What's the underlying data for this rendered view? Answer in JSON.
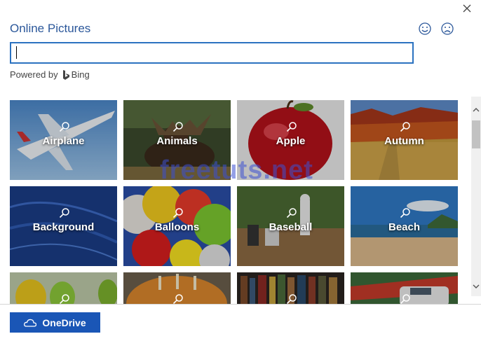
{
  "dialog": {
    "title": "Online Pictures",
    "close_icon": "close-icon",
    "feedback": {
      "smile_icon": "smile-icon",
      "frown_icon": "frown-icon"
    }
  },
  "search": {
    "value": "",
    "placeholder": ""
  },
  "powered_by": {
    "text": "Powered by",
    "brand": "Bing"
  },
  "categories": [
    {
      "label": "Airplane",
      "icon": "search-icon"
    },
    {
      "label": "Animals",
      "icon": "search-icon"
    },
    {
      "label": "Apple",
      "icon": "search-icon"
    },
    {
      "label": "Autumn",
      "icon": "search-icon"
    },
    {
      "label": "Background",
      "icon": "search-icon"
    },
    {
      "label": "Balloons",
      "icon": "search-icon"
    },
    {
      "label": "Baseball",
      "icon": "search-icon"
    },
    {
      "label": "Beach",
      "icon": "search-icon"
    },
    {
      "label": "",
      "icon": "search-icon"
    },
    {
      "label": "",
      "icon": "search-icon"
    },
    {
      "label": "",
      "icon": "search-icon"
    },
    {
      "label": "",
      "icon": "search-icon"
    }
  ],
  "footer": {
    "onedrive_label": "OneDrive",
    "onedrive_icon": "cloud-icon"
  },
  "watermark": "freetuts.net",
  "colors": {
    "title": "#2b579a",
    "accent_button": "#1a56b6",
    "search_border": "#2b72c0"
  }
}
